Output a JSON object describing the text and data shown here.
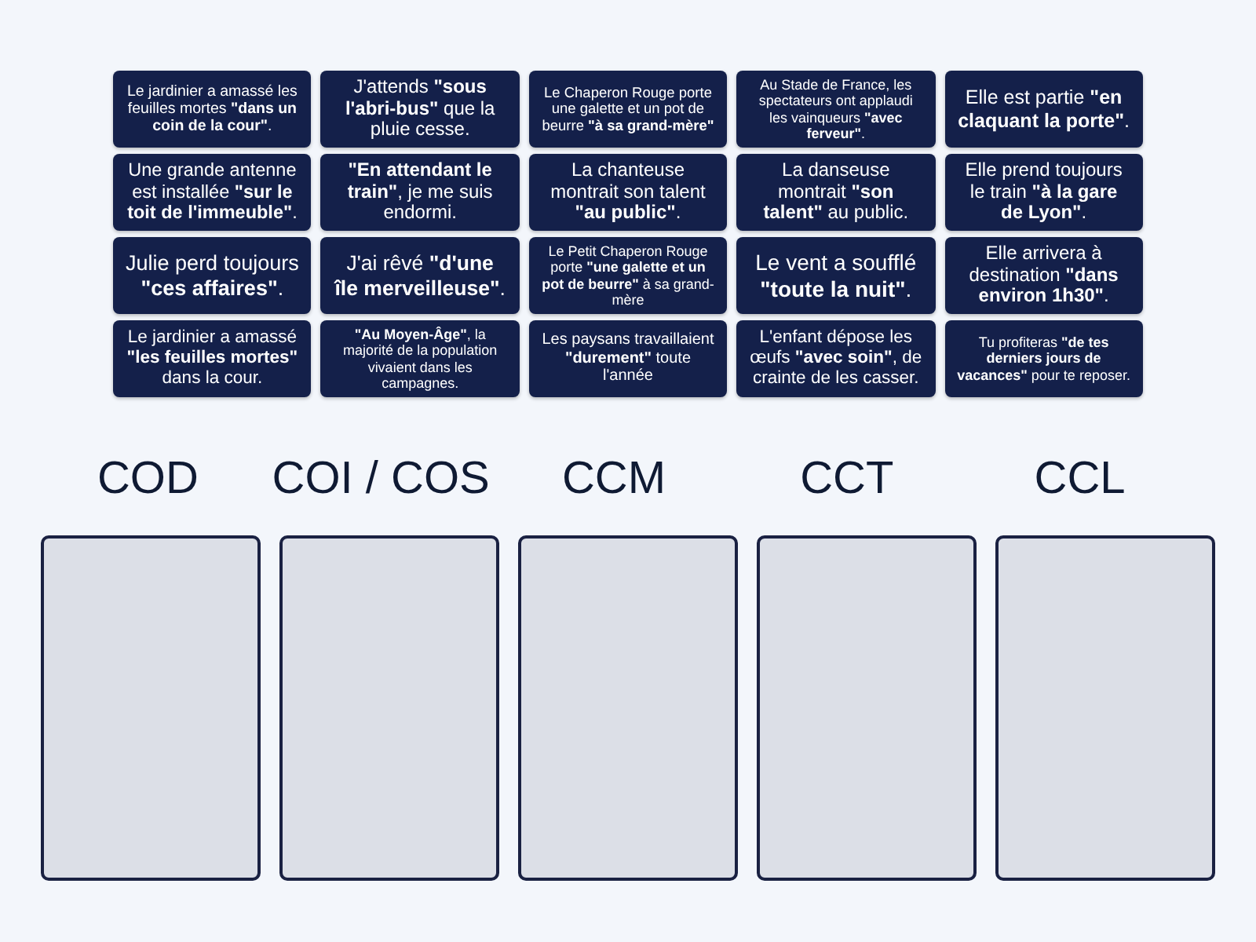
{
  "cards": [
    "Le jardinier a amassé les feuilles mortes **\"dans un coin de la cour\"**.",
    "J'attends **\"sous l'abri-bus\"** que la pluie cesse.",
    "Le Chaperon Rouge porte une galette et un pot de beurre **\"à sa grand-mère\"**",
    "Au Stade de France, les spectateurs ont applaudi les vainqueurs **\"avec ferveur\"**.",
    "Elle est partie **\"en claquant la porte\"**.",
    "Une grande antenne est installée **\"sur le toit de l'immeuble\"**.",
    "**\"En attendant le train\"**, je me suis endormi.",
    "La chanteuse montrait son talent **\"au public\"**.",
    "La danseuse montrait **\"son talent\"** au public.",
    "Elle prend toujours le train **\"à la gare de Lyon\"**.",
    "Julie perd toujours **\"ces affaires\"**.",
    "J'ai rêvé **\"d'une île merveilleuse\"**.",
    "Le Petit Chaperon Rouge porte **\"une galette et un pot de beurre\"** à sa grand-mère",
    "Le vent a soufflé **\"toute la nuit\"**.",
    "Elle arrivera à destination **\"dans environ 1h30\"**.",
    "Le jardinier a amassé **\"les feuilles mortes\"** dans la cour.",
    "**\"Au Moyen-Âge\"**, la majorité de la population vivaient dans les campagnes.",
    "Les paysans travaillaient **\"durement\"** toute l'année",
    "L'enfant dépose les œufs **\"avec soin\"**, de crainte de les casser.",
    "Tu profiteras **\"de tes derniers jours de vacances\"** pour te reposer."
  ],
  "categories": [
    "COD",
    "COI / COS",
    "CCM",
    "CCT",
    "CCL"
  ]
}
